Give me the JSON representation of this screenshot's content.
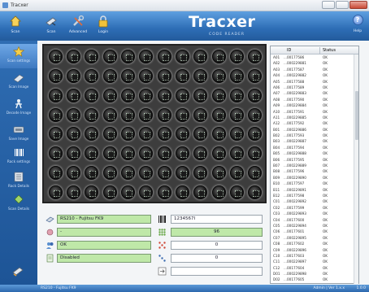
{
  "window": {
    "title": "Tracxer"
  },
  "toolbar": {
    "items": [
      {
        "label": "Scan",
        "icon": "home-icon"
      },
      {
        "label": "Scan",
        "icon": "scanner-icon"
      },
      {
        "label": "Advanced",
        "icon": "tools-icon"
      },
      {
        "label": "Login",
        "icon": "lock-icon"
      }
    ],
    "brand": "Tracxer",
    "brand_sub": "CODE READER",
    "help_label": "Help"
  },
  "sidebar": {
    "items": [
      {
        "label": "Scan settings",
        "icon": "star-icon"
      },
      {
        "label": "Scan Image",
        "icon": "image-icon"
      },
      {
        "label": "Decode Image",
        "icon": "decode-icon"
      },
      {
        "label": "Save Image",
        "icon": "save-icon"
      },
      {
        "label": "Rack settings",
        "icon": "barcode-icon"
      },
      {
        "label": "Rack Details",
        "icon": "rack-icon"
      },
      {
        "label": "Scan Details",
        "icon": "details-icon"
      }
    ]
  },
  "rack": {
    "rows": 8,
    "cols": 12
  },
  "info": {
    "scanner_field": "RS210 - Fujitsu FK9",
    "barcode_field": "1234567I",
    "tubes_field": "-",
    "count_field": "96",
    "status_field": "OK",
    "errors_field": "0",
    "mode_field": "Disabled",
    "empty_field": "0",
    "extra_field": ""
  },
  "table": {
    "headers": {
      "id": "ID",
      "status": "Status"
    },
    "rows": [
      {
        "n": "A01",
        "id": "...00177586",
        "status": "OK"
      },
      {
        "n": "A02",
        "id": "...000229881",
        "status": "OK"
      },
      {
        "n": "A03",
        "id": "...00177587",
        "status": "OK"
      },
      {
        "n": "A04",
        "id": "...000229882",
        "status": "OK"
      },
      {
        "n": "A05",
        "id": "...00177588",
        "status": "OK"
      },
      {
        "n": "A06",
        "id": "...00177589",
        "status": "OK"
      },
      {
        "n": "A07",
        "id": "...000229883",
        "status": "OK"
      },
      {
        "n": "A08",
        "id": "...00177590",
        "status": "OK"
      },
      {
        "n": "A09",
        "id": "...000229884",
        "status": "OK"
      },
      {
        "n": "A10",
        "id": "...00177591",
        "status": "OK"
      },
      {
        "n": "A11",
        "id": "...000229885",
        "status": "OK"
      },
      {
        "n": "A12",
        "id": "...00177592",
        "status": "OK"
      },
      {
        "n": "B01",
        "id": "...000229886",
        "status": "OK"
      },
      {
        "n": "B02",
        "id": "...00177593",
        "status": "OK"
      },
      {
        "n": "B03",
        "id": "...000229887",
        "status": "OK"
      },
      {
        "n": "B04",
        "id": "...00177594",
        "status": "OK"
      },
      {
        "n": "B05",
        "id": "...000229888",
        "status": "OK"
      },
      {
        "n": "B06",
        "id": "...00177595",
        "status": "OK"
      },
      {
        "n": "B07",
        "id": "...000229889",
        "status": "OK"
      },
      {
        "n": "B08",
        "id": "...00177596",
        "status": "OK"
      },
      {
        "n": "B09",
        "id": "...000229890",
        "status": "OK"
      },
      {
        "n": "B10",
        "id": "...00177597",
        "status": "OK"
      },
      {
        "n": "B11",
        "id": "...000229891",
        "status": "OK"
      },
      {
        "n": "B12",
        "id": "...00177598",
        "status": "OK"
      },
      {
        "n": "C01",
        "id": "...000229892",
        "status": "OK"
      },
      {
        "n": "C02",
        "id": "...00177599",
        "status": "OK"
      },
      {
        "n": "C03",
        "id": "...000229893",
        "status": "OK"
      },
      {
        "n": "C04",
        "id": "...00177600",
        "status": "OK"
      },
      {
        "n": "C05",
        "id": "...000229894",
        "status": "OK"
      },
      {
        "n": "C06",
        "id": "...00177601",
        "status": "OK"
      },
      {
        "n": "C07",
        "id": "...000229895",
        "status": "OK"
      },
      {
        "n": "C08",
        "id": "...00177602",
        "status": "OK"
      },
      {
        "n": "C09",
        "id": "...000229896",
        "status": "OK"
      },
      {
        "n": "C10",
        "id": "...00177603",
        "status": "OK"
      },
      {
        "n": "C11",
        "id": "...000229897",
        "status": "OK"
      },
      {
        "n": "C12",
        "id": "...00177604",
        "status": "OK"
      },
      {
        "n": "D01",
        "id": "...000229898",
        "status": "OK"
      },
      {
        "n": "D02",
        "id": "...00177605",
        "status": "OK"
      }
    ]
  },
  "statusbar": {
    "left": "RS210 - Fujitsu FK9",
    "right": "Admin  |  Ver 1.x.x",
    "right2": "1.0.0"
  }
}
